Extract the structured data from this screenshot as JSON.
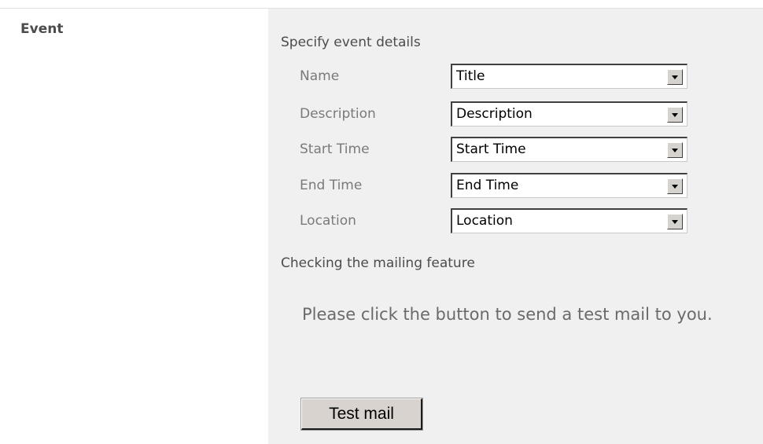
{
  "left": {
    "label": "Event"
  },
  "panel": {
    "heading": "Specify event details",
    "fields": [
      {
        "label": "Name",
        "value": "Title"
      },
      {
        "label": "Description",
        "value": "Description"
      },
      {
        "label": "Start Time",
        "value": "Start Time"
      },
      {
        "label": "End Time",
        "value": "End Time"
      },
      {
        "label": "Location",
        "value": "Location"
      }
    ],
    "mailing_heading": "Checking the mailing feature",
    "instruction": "Please click the button to send a test mail to you.",
    "test_button_label": "Test mail"
  }
}
